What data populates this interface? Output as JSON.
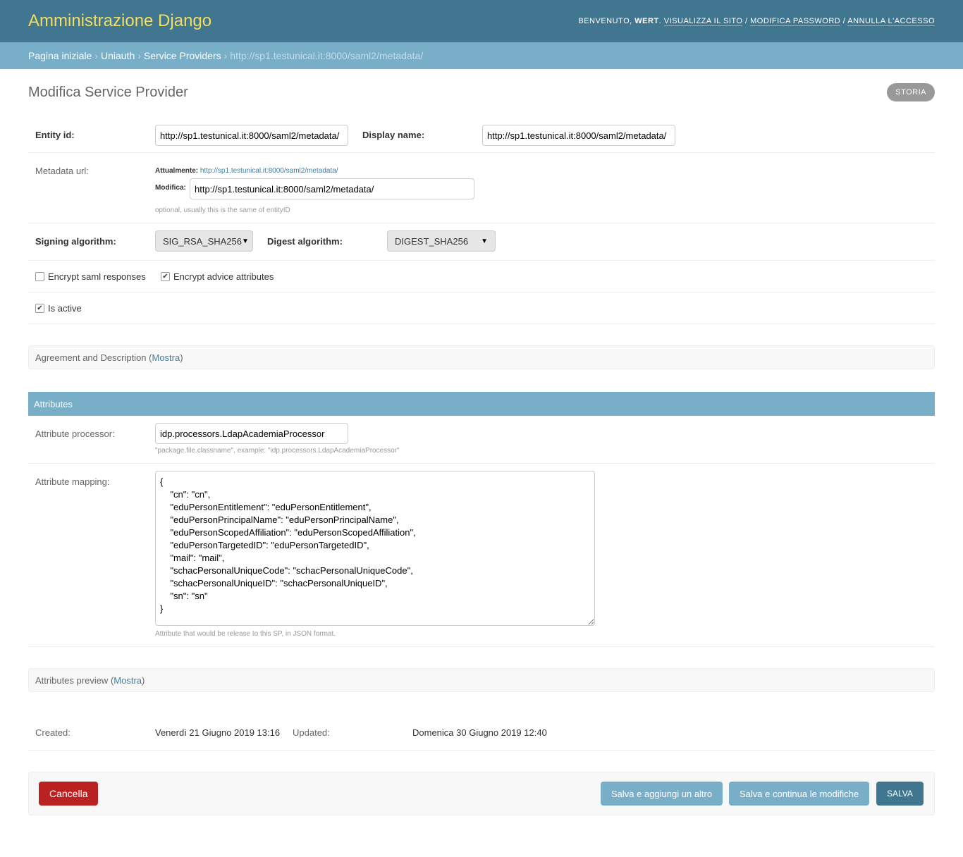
{
  "header": {
    "site_name": "Amministrazione Django",
    "welcome": "Benvenuto,",
    "user": "wert",
    "view_site": "Visualizza il sito",
    "change_password": "Modifica password",
    "logout": "Annulla l'accesso"
  },
  "breadcrumbs": {
    "home": "Pagina iniziale",
    "app": "Uniauth",
    "model": "Service Providers",
    "current": "http://sp1.testunical.it:8000/saml2/metadata/",
    "separator": "›"
  },
  "page": {
    "title": "Modifica Service Provider",
    "history_button": "Storia"
  },
  "form": {
    "entity_id": {
      "label": "Entity id:",
      "value": "http://sp1.testunical.it:8000/saml2/metadata/"
    },
    "display_name": {
      "label": "Display name:",
      "value": "http://sp1.testunical.it:8000/saml2/metadata/"
    },
    "metadata_url": {
      "label": "Metadata url:",
      "currently_label": "Attualmente:",
      "currently_value": "http://sp1.testunical.it:8000/saml2/metadata/",
      "change_label": "Modifica:",
      "value": "http://sp1.testunical.it:8000/saml2/metadata/",
      "help": "optional, usually this is the same of entityID"
    },
    "signing_algorithm": {
      "label": "Signing algorithm:",
      "selected": "SIG_RSA_SHA256"
    },
    "digest_algorithm": {
      "label": "Digest algorithm:",
      "selected": "DIGEST_SHA256"
    },
    "encrypt_saml_responses": {
      "label": "Encrypt saml responses",
      "checked": false
    },
    "encrypt_advice_attributes": {
      "label": "Encrypt advice attributes",
      "checked": true
    },
    "is_active": {
      "label": "Is active",
      "checked": true
    }
  },
  "fieldsets": {
    "agreement": {
      "title": "Agreement and Description",
      "toggle": "Mostra"
    },
    "attributes": {
      "title": "Attributes"
    },
    "attributes_preview": {
      "title": "Attributes preview",
      "toggle": "Mostra"
    }
  },
  "attributes": {
    "processor": {
      "label": "Attribute processor:",
      "value": "idp.processors.LdapAcademiaProcessor",
      "help": "\"package.file.classname\", example: \"idp.processors.LdapAcademiaProcessor\""
    },
    "mapping": {
      "label": "Attribute mapping:",
      "value": "{\n    \"cn\": \"cn\",\n    \"eduPersonEntitlement\": \"eduPersonEntitlement\",\n    \"eduPersonPrincipalName\": \"eduPersonPrincipalName\",\n    \"eduPersonScopedAffiliation\": \"eduPersonScopedAffiliation\",\n    \"eduPersonTargetedID\": \"eduPersonTargetedID\",\n    \"mail\": \"mail\",\n    \"schacPersonalUniqueCode\": \"schacPersonalUniqueCode\",\n    \"schacPersonalUniqueID\": \"schacPersonalUniqueID\",\n    \"sn\": \"sn\"\n}",
      "help": "Attribute that would be release to this SP, in JSON format."
    }
  },
  "meta": {
    "created_label": "Created:",
    "created_value": "Venerdì 21 Giugno 2019 13:16",
    "updated_label": "Updated:",
    "updated_value": "Domenica 30 Giugno 2019 12:40"
  },
  "submit": {
    "delete": "Cancella",
    "save_add_another": "Salva e aggiungi un altro",
    "save_continue": "Salva e continua le modifiche",
    "save": "Salva"
  },
  "colors": {
    "header_bg": "#417690",
    "breadcrumb_bg": "#79aec8",
    "site_name": "#f5dd5d",
    "delete_button": "#ba2121",
    "secondary_button": "#79aec8",
    "default_button": "#417690"
  }
}
